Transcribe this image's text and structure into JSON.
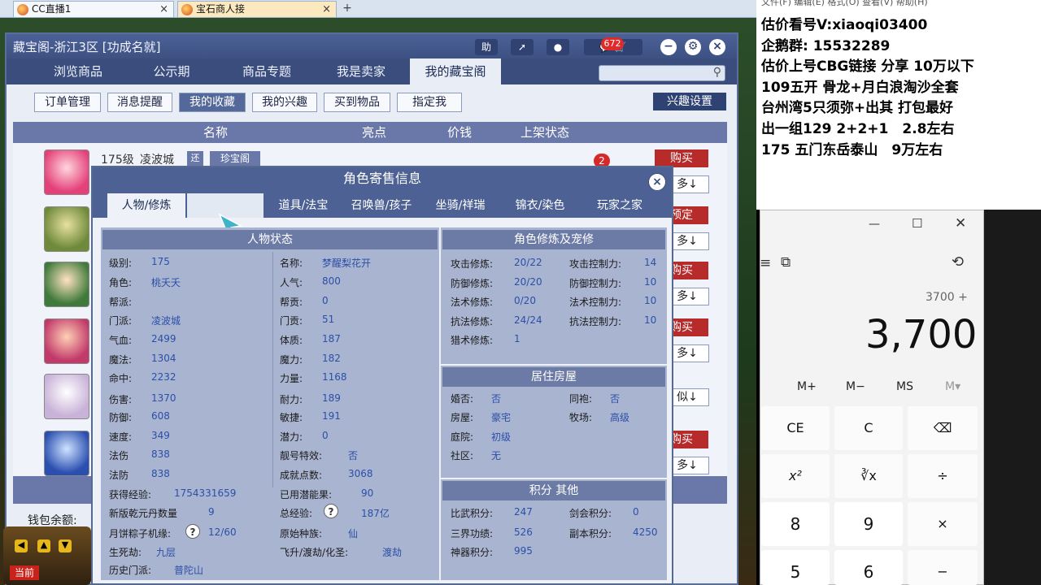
{
  "browser_tabs": [
    {
      "label": "CC直播1"
    },
    {
      "label": "宝石商人接"
    }
  ],
  "window": {
    "title": "藏宝阁-浙江3区 [功成名就]",
    "help": "助",
    "cart_badge": "672"
  },
  "nav": [
    "浏览商品",
    "公示期",
    "商品专题",
    "我是卖家",
    "我的藏宝阁"
  ],
  "subnav": [
    "订单管理",
    "消息提醒",
    "我的收藏",
    "我的兴趣",
    "买到物品",
    "指定我"
  ],
  "interest_btn": "兴趣设置",
  "table_header": [
    "名称",
    "亮点",
    "价钱",
    "上架状态"
  ],
  "first_row": {
    "level": "175级",
    "school": "凌波城",
    "tag1": "还",
    "tag2": "珍宝阁",
    "badge": "2"
  },
  "row_buttons": [
    {
      "buy": "购买",
      "more": "多↓"
    },
    {
      "buy": "预定",
      "more": "多↓"
    },
    {
      "buy": "购买",
      "more": "多↓"
    },
    {
      "buy": "购买",
      "more": "多↓"
    },
    {
      "buy": "",
      "more": "似↓"
    },
    {
      "buy": "购买",
      "more": "多↓"
    }
  ],
  "wallet": "钱包余额:",
  "popup": {
    "title": "角色寄售信息",
    "tabs": [
      "人物/修炼",
      "",
      "道具/法宝",
      "召唤兽/孩子",
      "坐骑/祥瑞",
      "锦衣/染色",
      "玩家之家"
    ],
    "sec_status": "人物状态",
    "sec_cultivation": "角色修炼及宠修",
    "sec_house": "居住房屋",
    "sec_score": "积分 其他",
    "left_col": [
      [
        "级别:",
        "175"
      ],
      [
        "角色:",
        "桃夭夭"
      ],
      [
        "帮派:",
        ""
      ],
      [
        "门派:",
        "凌波城"
      ],
      [
        "气血:",
        "2499"
      ],
      [
        "魔法:",
        "1304"
      ],
      [
        "命中:",
        "2232"
      ],
      [
        "伤害:",
        "1370"
      ],
      [
        "防御:",
        "608"
      ],
      [
        "速度:",
        "349"
      ],
      [
        "法伤",
        "838"
      ],
      [
        "法防",
        "838"
      ]
    ],
    "mid_col": [
      [
        "名称:",
        "梦醒梨花开"
      ],
      [
        "人气:",
        "800"
      ],
      [
        "帮贡:",
        "0"
      ],
      [
        "门贡:",
        "51"
      ],
      [
        "体质:",
        "187"
      ],
      [
        "魔力:",
        "182"
      ],
      [
        "力量:",
        "1168"
      ],
      [
        "耐力:",
        "189"
      ],
      [
        "敏捷:",
        "191"
      ],
      [
        "潜力:",
        "0"
      ],
      [
        "靓号特效:",
        "否"
      ],
      [
        "成就点数:",
        "3068"
      ]
    ],
    "exp": [
      "获得经验:",
      "1754331659"
    ],
    "potential": [
      "已用潜能果:",
      "90"
    ],
    "qianyuan": [
      "新版乾元丹数量",
      "9"
    ],
    "total_exp": [
      "总经验:",
      "187亿"
    ],
    "mooncake": [
      "月饼粽子机缘:",
      "12/60"
    ],
    "race": [
      "原始种族:",
      "仙"
    ],
    "shengsi": [
      "生死劫:",
      "九层"
    ],
    "feisheng": [
      "飞升/渡劫/化圣:",
      "渡劫"
    ],
    "history": [
      "历史门派:",
      "普陀山"
    ],
    "cult_left": [
      [
        "攻击修炼:",
        "20/22"
      ],
      [
        "防御修炼:",
        "20/20"
      ],
      [
        "法术修炼:",
        "0/20"
      ],
      [
        "抗法修炼:",
        "24/24"
      ],
      [
        "猎术修炼:",
        "1"
      ]
    ],
    "cult_right": [
      [
        "攻击控制力:",
        "14"
      ],
      [
        "防御控制力:",
        "10"
      ],
      [
        "法术控制力:",
        "10"
      ],
      [
        "抗法控制力:",
        "10"
      ]
    ],
    "house_left": [
      [
        "婚否:",
        "否"
      ],
      [
        "房屋:",
        "豪宅"
      ],
      [
        "庭院:",
        "初级"
      ],
      [
        "社区:",
        "无"
      ]
    ],
    "house_right": [
      [
        "同袍:",
        "否"
      ],
      [
        "牧场:",
        "高级"
      ]
    ],
    "score_left": [
      [
        "比武积分:",
        "247"
      ],
      [
        "三界功绩:",
        "526"
      ],
      [
        "神器积分:",
        "995"
      ]
    ],
    "score_right": [
      [
        "剑会积分:",
        "0"
      ],
      [
        "副本积分:",
        "4250"
      ]
    ]
  },
  "bottom_left": "当前",
  "right_text": [
    "估价看号V:xiaoqi03400",
    "企鹅群: 15532289",
    "估价上号CBG链接 分享 10万以下",
    "109五开 骨龙+月白浪淘沙全套",
    "台州湾5只须弥+出其 打包最好",
    "出一组129 2+2+1　2.8左右",
    "175 五门东岳泰山　9万左右"
  ],
  "menu_strip": "文件(F)  编辑(E)  格式(O)  查看(V)  帮助(H)",
  "calc": {
    "expr": "3700 +",
    "display": "3,700",
    "memory": [
      "M+",
      "M−",
      "MS",
      "M▾"
    ],
    "row1": [
      "CE",
      "C",
      "⌫"
    ],
    "row2": [
      "x²",
      "∛x",
      "÷"
    ],
    "row3": [
      "8",
      "9",
      "×"
    ],
    "row4": [
      "5",
      "6",
      "−"
    ]
  }
}
